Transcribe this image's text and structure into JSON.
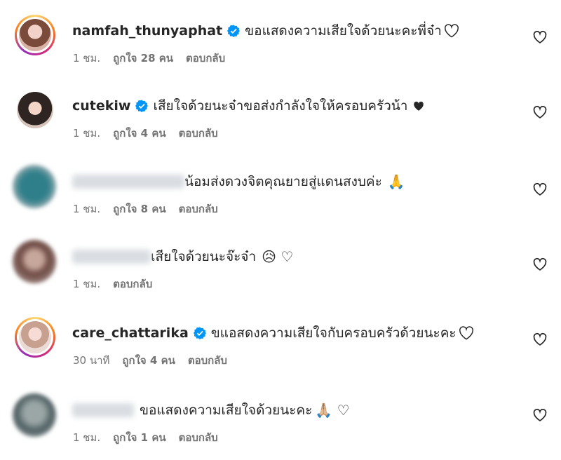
{
  "comments": [
    {
      "username": "namfah_thunyaphat",
      "verified": true,
      "text": "ขอแสดงความเสียใจด้วยนะคะพี่จ๋า",
      "trailing": "heart-outline",
      "time": "1 ชม.",
      "likes": "ถูกใจ 28 คน",
      "reply": "ตอบกลับ",
      "avatar_style": "story-ring",
      "avatar_color": "#c98f84"
    },
    {
      "username": "cutekiw",
      "verified": true,
      "text": "เสียใจด้วยนะจ๋าขอส่งกำลังใจให้ครอบครัวน้า",
      "trailing": "heart-solid",
      "time": "1 ชม.",
      "likes": "ถูกใจ 4 คน",
      "reply": "ตอบกลับ",
      "avatar_style": "plain",
      "avatar_color": "#3b2f2c"
    },
    {
      "username": "",
      "verified": false,
      "text": "น้อมส่งดวงจิตคุณยายสู่แดนสงบค่ะ",
      "trailing": "🙏",
      "time": "1 ชม.",
      "likes": "ถูกใจ 8 คน",
      "reply": "ตอบกลับ",
      "avatar_style": "blurred",
      "avatar_color": "#2f7f8a"
    },
    {
      "username": "",
      "verified": false,
      "text": "เสียใจด้วยนะจ๊ะจ๋า",
      "trailing": "😥 ♡",
      "time": "1 ชม.",
      "likes": "",
      "reply": "ตอบกลับ",
      "avatar_style": "blurred",
      "avatar_color": "#8b5e56"
    },
    {
      "username": "care_chattarika",
      "verified": true,
      "text": "ขแอสดงความเสียใจกับครอบครัวด้วยนะคะ",
      "trailing": "heart-outline",
      "time": "30 นาที",
      "likes": "ถูกใจ 4 คน",
      "reply": "ตอบกลับ",
      "avatar_style": "story-ring",
      "avatar_color": "#e9c7c0"
    },
    {
      "username": "",
      "verified": false,
      "text": "ขอแสดงความเสียใจด้วยนะคะ",
      "trailing": "🙏🏼 ♡",
      "time": "1 ชม.",
      "likes": "ถูกใจ 1 คน",
      "reply": "ตอบกลับ",
      "avatar_style": "blurred",
      "avatar_color": "#5d6f74"
    }
  ],
  "colors": {
    "verified": "#0095f6",
    "muted": "#737373",
    "text": "#262626"
  }
}
